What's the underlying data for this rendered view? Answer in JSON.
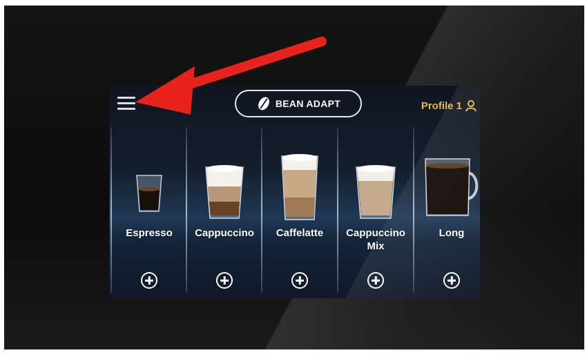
{
  "header": {
    "bean_adapt_label": "BEAN ADAPT",
    "profile_label": "Profile 1"
  },
  "drinks": [
    {
      "label": "Espresso"
    },
    {
      "label": "Cappuccino"
    },
    {
      "label": "Caffelatte"
    },
    {
      "label": "Cappuccino Mix"
    },
    {
      "label": "Long"
    }
  ],
  "icons": {
    "menu": "hamburger-menu-icon",
    "bean": "coffee-bean-icon",
    "profile": "person-icon",
    "add": "plus-circle-icon",
    "annotation": "red-arrow-icon"
  },
  "colors": {
    "profile_accent": "#e8b84a",
    "annotation_arrow": "#e8231b",
    "screen_background": "#141e2c"
  }
}
